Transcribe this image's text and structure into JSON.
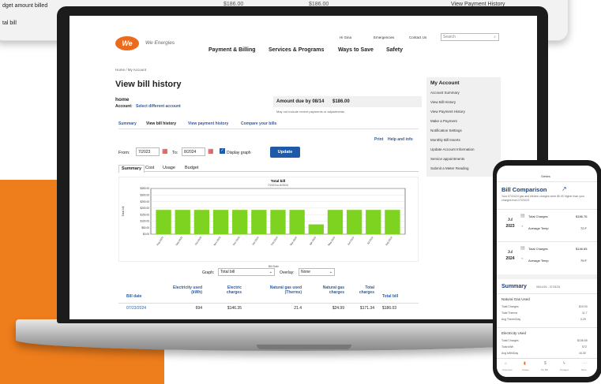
{
  "background_card": {
    "budget_line": "dget amount billed",
    "total_line": "tal bill",
    "amount_1": "$186.00",
    "amount_2": "$186.00",
    "view_payment_history": "View Payment History"
  },
  "header": {
    "logo_text": "We",
    "brand": "We Energies",
    "user_menu": "Hi Gina",
    "emergencies": "Emergencies",
    "contact": "Contact Us",
    "search_placeholder": "Search",
    "nav": [
      "Payment & Billing",
      "Services & Programs",
      "Ways to Save",
      "Safety"
    ]
  },
  "breadcrumb": "Home / My Account",
  "page_title": "View bill history",
  "account": {
    "name": "home",
    "label": "Account:",
    "select_link": "Select different account"
  },
  "amount_due": {
    "label": "Amount due by 08/14",
    "value": "$186.00",
    "note": "May not include recent payments or adjustments"
  },
  "subnav": [
    "Summary",
    "View bill history",
    "View payment history",
    "Compare your bills"
  ],
  "actions": {
    "print": "Print",
    "help": "Help and info"
  },
  "filters": {
    "from_label": "From:",
    "from_value": "7/2023",
    "to_label": "To:",
    "to_value": "8/2024",
    "display_graph": "Display graph",
    "update": "Update"
  },
  "tabs": [
    "Summary",
    "Cost",
    "Usage",
    "Budget"
  ],
  "chart_data": {
    "type": "bar",
    "title": "Total bill",
    "subtitle": "7/2023 to 8/2024",
    "xlabel": "Bill Date",
    "ylabel": "Total bill",
    "ylim": [
      0,
      350
    ],
    "ytick_labels": [
      "$350.00",
      "$300.00",
      "$250.00",
      "$200.00",
      "$150.00",
      "$100.00",
      "$50.00",
      "$0.00"
    ],
    "categories": [
      "Aug-2023",
      "Sep-2023",
      "Oct-2023",
      "Nov-2023",
      "Dec-2023",
      "Jan-2024",
      "Feb-2024",
      "Mar-2024",
      "Apr-2024",
      "May-2024",
      "Jun-2024",
      "Jul-2024",
      "Aug-2024"
    ],
    "values": [
      186,
      186,
      186,
      186,
      186,
      186,
      186,
      186,
      75,
      186,
      186,
      186,
      186
    ],
    "color": "#7ed321"
  },
  "graph_controls": {
    "graph_label": "Graph:",
    "graph_value": "Total bill",
    "overlay_label": "Overlay:",
    "overlay_value": "None"
  },
  "table": {
    "headers": [
      "Bill date",
      "Electricity used (kWh)",
      "Electric charges",
      "Natural gas used (Therms)",
      "Natural gas charges",
      "Total charges",
      "Total bill"
    ],
    "rows": [
      [
        "07/23/2024",
        "694",
        "$146.35",
        "21.4",
        "$24.99",
        "$171.34",
        "$186.03"
      ]
    ]
  },
  "sidebar": {
    "title": "My Account",
    "items": [
      "Account Summary",
      "View Bill History",
      "View Payment History",
      "Make a Payment",
      "Notification Settings",
      "Monthly Bill Inserts",
      "Update Account Information",
      "Service appointments",
      "Submit a Meter Reading"
    ]
  },
  "phone": {
    "header": "Gettes",
    "comparison_title": "Bill Comparison",
    "comparison_desc": "Your 07/24/24 gas and electric charges were $0.00 higher than your charges from 07/24/23",
    "blocks": [
      {
        "month": "Jul",
        "year": "2023",
        "charges_label": "Total Charges",
        "charges": "$186.76",
        "temp_label": "Average Temp",
        "temp": "72 F"
      },
      {
        "month": "Jul",
        "year": "2024",
        "charges_label": "Total Charges",
        "charges": "$146.65",
        "temp_label": "Average Temp",
        "temp": "79 F"
      }
    ],
    "summary_title": "Summary",
    "summary_range": "06/14/24 - 07/24/24",
    "gas_title": "Natural Gas Used",
    "gas_rows": [
      [
        "Total Charges",
        "$19.00"
      ],
      [
        "Total Therms",
        "11.7"
      ],
      [
        "Avg Therm/Day",
        "0.29"
      ]
    ],
    "elec_title": "Electricity Used",
    "elec_rows": [
      [
        "Total Charges",
        "$136.55"
      ],
      [
        "Total kWh",
        "572"
      ],
      [
        "Avg kWh/Day",
        "16.30"
      ]
    ],
    "tabbar": [
      "Overview",
      "Usage",
      "My Bill",
      "Outages",
      "More"
    ]
  }
}
